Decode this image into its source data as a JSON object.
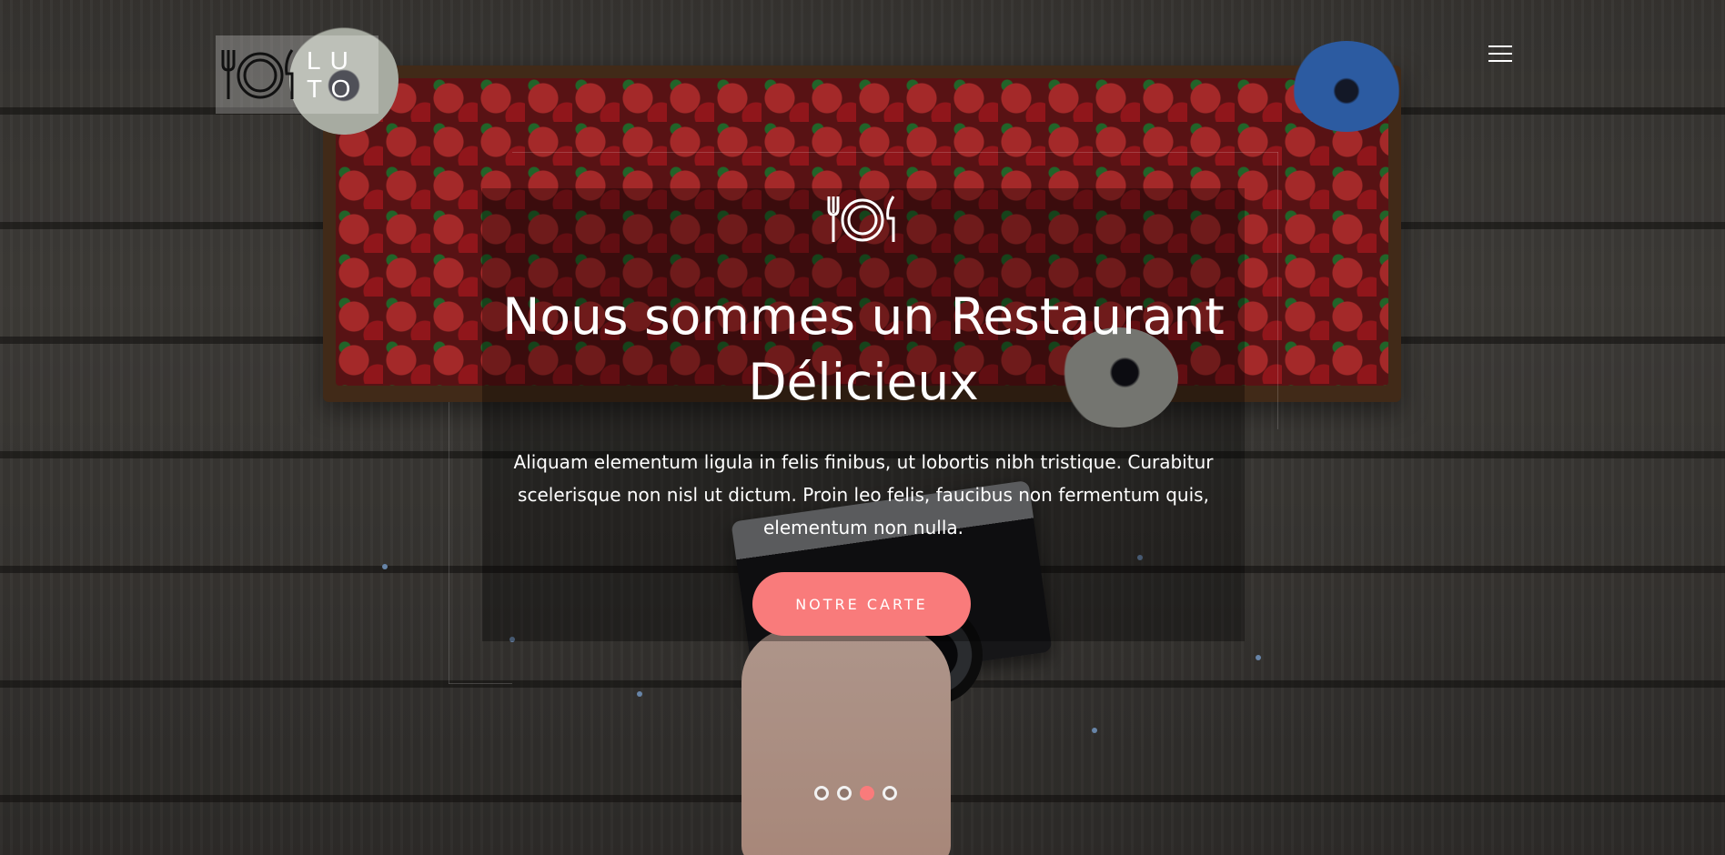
{
  "brand": {
    "logo_line1": "LU",
    "logo_line2": "TO",
    "logo_icon": "cutlery-plate-icon"
  },
  "nav": {
    "menu_icon": "hamburger-menu-icon"
  },
  "hero": {
    "icon": "cutlery-plate-icon",
    "title_line1": "Nous sommes un Restaurant",
    "title_line2": "Délicieux",
    "description": "Aliquam elementum ligula in felis finibus, ut lobortis nibh tristique. Curabitur scelerisque non nisl ut dictum. Proin leo felis, faucibus non fermentum quis, elementum non nulla.",
    "cta_label": "NOTRE CARTE"
  },
  "slider": {
    "count": 4,
    "active_index": 2
  },
  "colors": {
    "accent": "#f97b7b",
    "text": "#ffffff"
  }
}
